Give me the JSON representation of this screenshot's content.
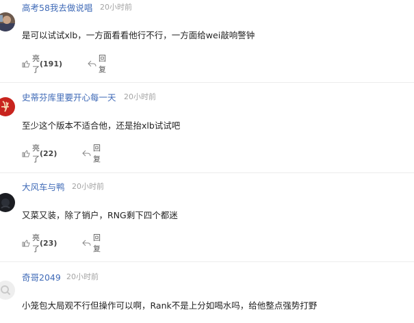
{
  "comments": [
    {
      "username": "高考58我去做说唱",
      "time": "20小时前",
      "text": "是可以试试xlb，一方面看看他行不行，一方面给wei敲响警钟",
      "like_label": "亮了",
      "like_count": "(191)",
      "reply_label": "回复",
      "avatar": "photo-avatar"
    },
    {
      "username": "史蒂芬库里要开心每一天",
      "time": "20小时前",
      "text": "至少这个版本不适合他，还是抬xlb试试吧",
      "like_label": "亮了",
      "like_count": "(22)",
      "reply_label": "回复",
      "avatar": "calligraphy-avatar"
    },
    {
      "username": "大风车与鸭",
      "time": "20小时前",
      "text": "又菜又装，除了销户，RNG剩下四个都迷",
      "like_label": "亮了",
      "like_count": "(23)",
      "reply_label": "回复",
      "avatar": "dark-avatar"
    },
    {
      "username": "奇哥2049",
      "time": "20小时前",
      "text": "小笼包大局观不行但操作可以啊，Rank不是上分如喝水吗，给他整点强势打野",
      "avatar": "default-avatar"
    }
  ],
  "colors": {
    "username": "#3f6ab7",
    "time": "#a3a3a3",
    "text": "#222222",
    "divider": "#ececec"
  },
  "icons": [
    "like-icon",
    "reply-icon"
  ]
}
